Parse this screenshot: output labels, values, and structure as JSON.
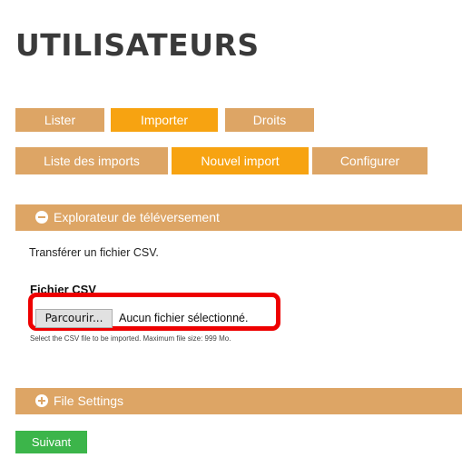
{
  "page": {
    "title": "UTILISATEURS"
  },
  "tabs": [
    {
      "label": "Lister",
      "active": false
    },
    {
      "label": "Importer",
      "active": true
    },
    {
      "label": "Droits",
      "active": false
    }
  ],
  "subtabs": [
    {
      "label": "Liste des imports",
      "active": false
    },
    {
      "label": "Nouvel import",
      "active": true
    },
    {
      "label": "Configurer",
      "active": false
    }
  ],
  "upload_section": {
    "title": "Explorateur de téléversement",
    "icon": "minus-circle-icon",
    "intro": "Transférer un fichier CSV.",
    "field_label": "Fichier CSV",
    "browse_label": "Parcourir...",
    "file_status": "Aucun fichier sélectionné.",
    "help": "Select the CSV file to be imported. Maximum file size: 999 Mo."
  },
  "file_settings": {
    "title": "File Settings",
    "icon": "plus-circle-icon"
  },
  "submit": {
    "label": "Suivant"
  },
  "colors": {
    "tab_inactive": "#dda565",
    "tab_active": "#f7a311",
    "highlight": "#ee0000",
    "submit": "#3cb54a"
  }
}
